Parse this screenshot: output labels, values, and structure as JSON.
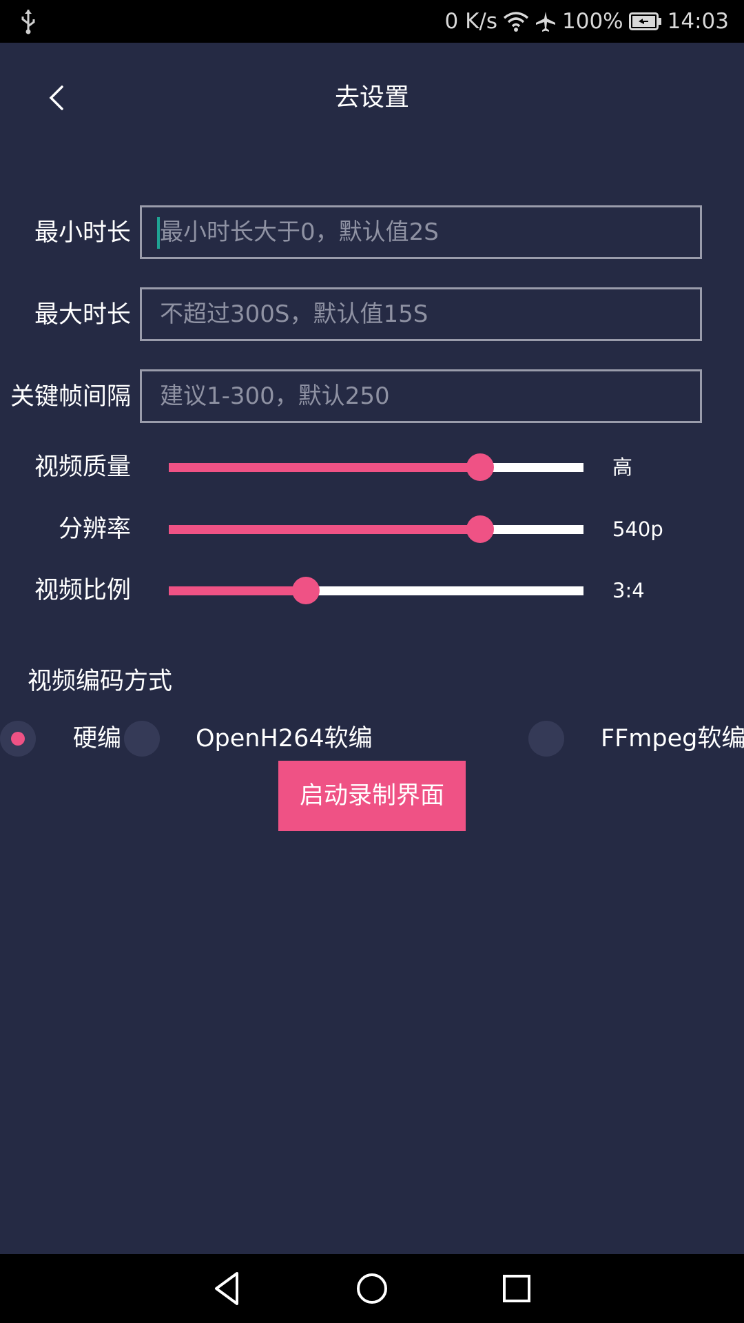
{
  "status_bar": {
    "network_speed": "0 K/s",
    "battery": "100%",
    "time": "14:03",
    "icons": [
      "usb-icon",
      "wifi-icon",
      "airplane-icon",
      "battery-icon"
    ]
  },
  "header": {
    "title": "去设置",
    "back_icon": "chevron-left-icon"
  },
  "fields": [
    {
      "label": "最小时长",
      "value": "",
      "placeholder": "最小时长大于0，默认值2S",
      "focused": true
    },
    {
      "label": "最大时长",
      "value": "",
      "placeholder": "不超过300S，默认值15S",
      "focused": false
    },
    {
      "label": "关键帧间隔",
      "value": "",
      "placeholder": "建议1-300，默认250",
      "focused": false
    }
  ],
  "sliders": [
    {
      "label": "视频质量",
      "value_text": "高",
      "level": 0.75
    },
    {
      "label": "分辨率",
      "value_text": "540p",
      "level": 0.75
    },
    {
      "label": "视频比例",
      "value_text": "3:4",
      "level": 0.33
    }
  ],
  "encoding": {
    "title": "视频编码方式",
    "options": [
      {
        "label": "硬编",
        "selected": true
      },
      {
        "label": "OpenH264软编",
        "selected": false
      },
      {
        "label": "FFmpeg软编",
        "selected": false
      }
    ]
  },
  "start_button": {
    "label": "启动录制界面"
  },
  "colors": {
    "background": "#252a44",
    "accent": "#ef5285",
    "input_border": "#9a9cab",
    "placeholder": "#8f92a3",
    "radio_bg": "#353a57"
  },
  "nav_bar": {
    "icons": [
      "back-triangle-icon",
      "home-circle-icon",
      "recents-square-icon"
    ]
  }
}
